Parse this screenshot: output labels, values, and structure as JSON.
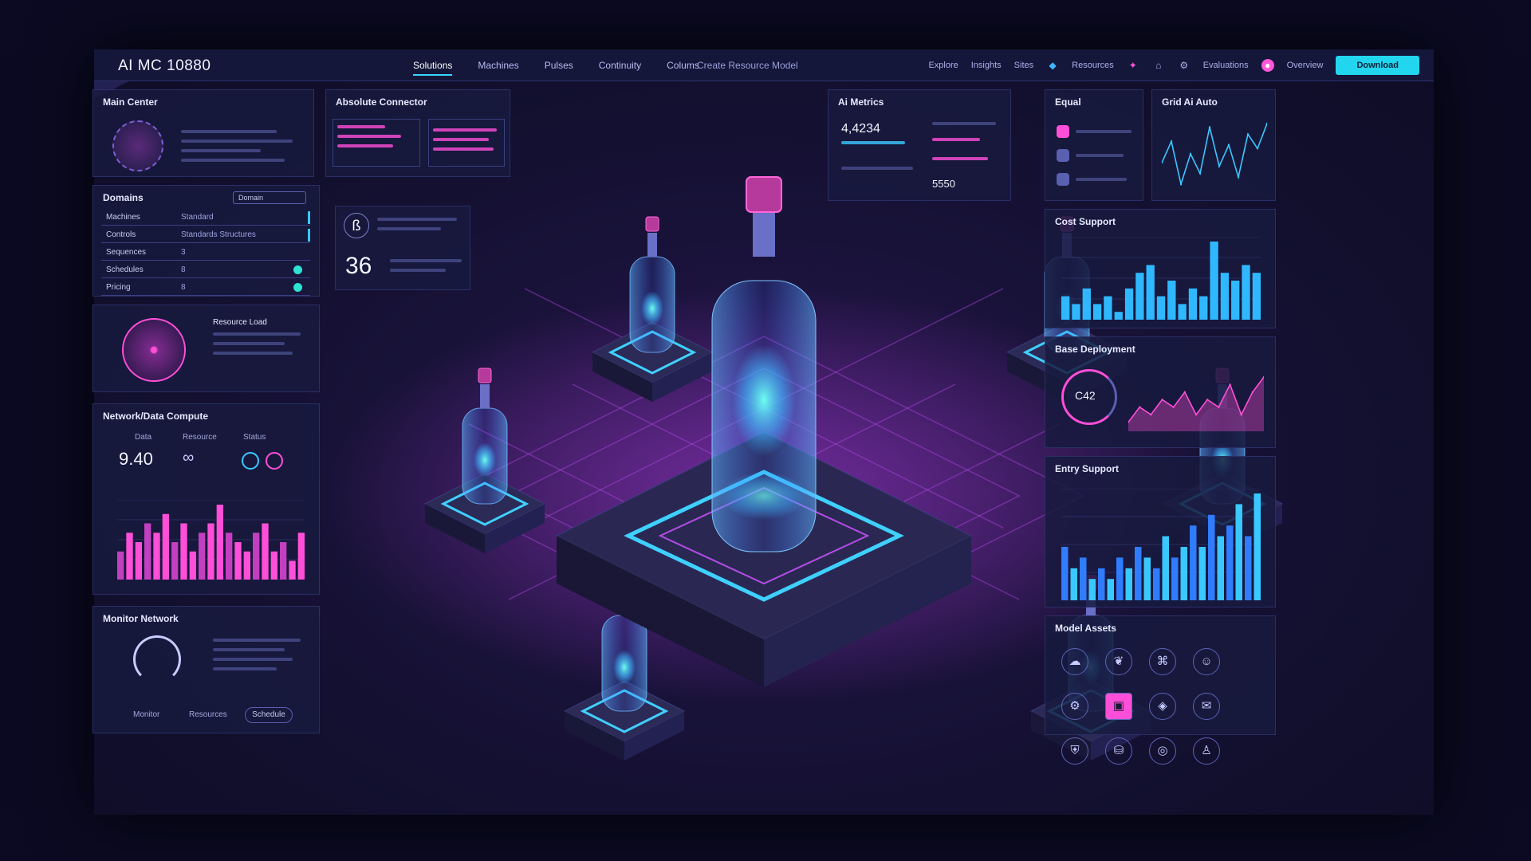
{
  "app": {
    "title": "AI MC 10880"
  },
  "nav": {
    "items": [
      "Solutions",
      "Machines",
      "Pulses",
      "Continuity",
      "Colums"
    ],
    "active": "Solutions",
    "extra": "Create Resource Model"
  },
  "top_right": {
    "links": [
      "Explore",
      "Insights",
      "Sites"
    ],
    "resources_label": "Resources",
    "settings_label": "Evaluations",
    "profile_label": "Overview",
    "primary_button": "Download"
  },
  "panels": {
    "main_center": {
      "title": "Main Center"
    },
    "available_connector": {
      "title": "Absolute Connector"
    },
    "domains": {
      "title": "Domains",
      "dropdown": "Domain",
      "rows": [
        {
          "name": "Machines",
          "value": "Standard"
        },
        {
          "name": "Controls",
          "value": "Standards Structures"
        },
        {
          "name": "Sequences",
          "value": "3"
        },
        {
          "name": "Schedules",
          "value": "8"
        },
        {
          "name": "Pricing",
          "value": "8"
        }
      ]
    },
    "stats": {
      "value_a": "36"
    },
    "info_card": {
      "heading": "Resource Load"
    },
    "network_compute": {
      "title": "Network/Data Compute",
      "col_labels": [
        "Data",
        "Resource",
        "Status"
      ],
      "big_value": "9.40",
      "series_colors": [
        "#ff4fd8",
        "#c23fc0"
      ]
    },
    "monitor": {
      "title": "Monitor Network",
      "button": "Schedule",
      "labels": [
        "Monitor",
        "Resources"
      ]
    },
    "iris_metrics": {
      "title": "Ai Metrics",
      "value": "4,4234",
      "value2": "5550"
    },
    "equal": {
      "title": "Equal"
    },
    "grid_ai": {
      "title": "Grid Ai Auto"
    },
    "cost_support": {
      "title": "Cost Support"
    },
    "base_deployment": {
      "title": "Base Deployment",
      "gauge_value": "C42"
    },
    "entity_support": {
      "title": "Entry Support"
    },
    "model_assets": {
      "title": "Model Assets"
    }
  },
  "chart_data": [
    {
      "type": "line",
      "title": "Grid Ai Auto",
      "series": [
        {
          "values": [
            0.5,
            0.62,
            0.38,
            0.55,
            0.44,
            0.7,
            0.48,
            0.6,
            0.42,
            0.66,
            0.58,
            0.72
          ]
        }
      ]
    },
    {
      "type": "bar",
      "title": "Cost Support",
      "values": [
        3,
        2,
        4,
        2,
        3,
        1,
        4,
        6,
        7,
        3,
        5,
        2,
        4,
        3,
        10,
        6,
        5,
        7,
        6
      ]
    },
    {
      "type": "area",
      "title": "Base Deployment",
      "values": [
        1,
        3,
        2,
        4,
        3,
        5,
        2,
        4,
        3,
        6,
        2,
        5,
        7
      ]
    },
    {
      "type": "bar",
      "title": "Entry Support",
      "values": [
        5,
        3,
        4,
        2,
        3,
        2,
        4,
        3,
        5,
        4,
        3,
        6,
        4,
        5,
        7,
        5,
        8,
        6,
        7,
        9,
        6,
        10
      ]
    },
    {
      "type": "bar",
      "title": "Network/Data Compute",
      "values": [
        3,
        5,
        4,
        6,
        5,
        7,
        4,
        6,
        3,
        5,
        6,
        8,
        5,
        4,
        3,
        5,
        6,
        3,
        4,
        2,
        5
      ]
    }
  ],
  "model_assets_icons": [
    "cloud",
    "brain",
    "network",
    "bot",
    "gear",
    "chip",
    "cube",
    "chat",
    "shield",
    "database",
    "globe",
    "user"
  ]
}
